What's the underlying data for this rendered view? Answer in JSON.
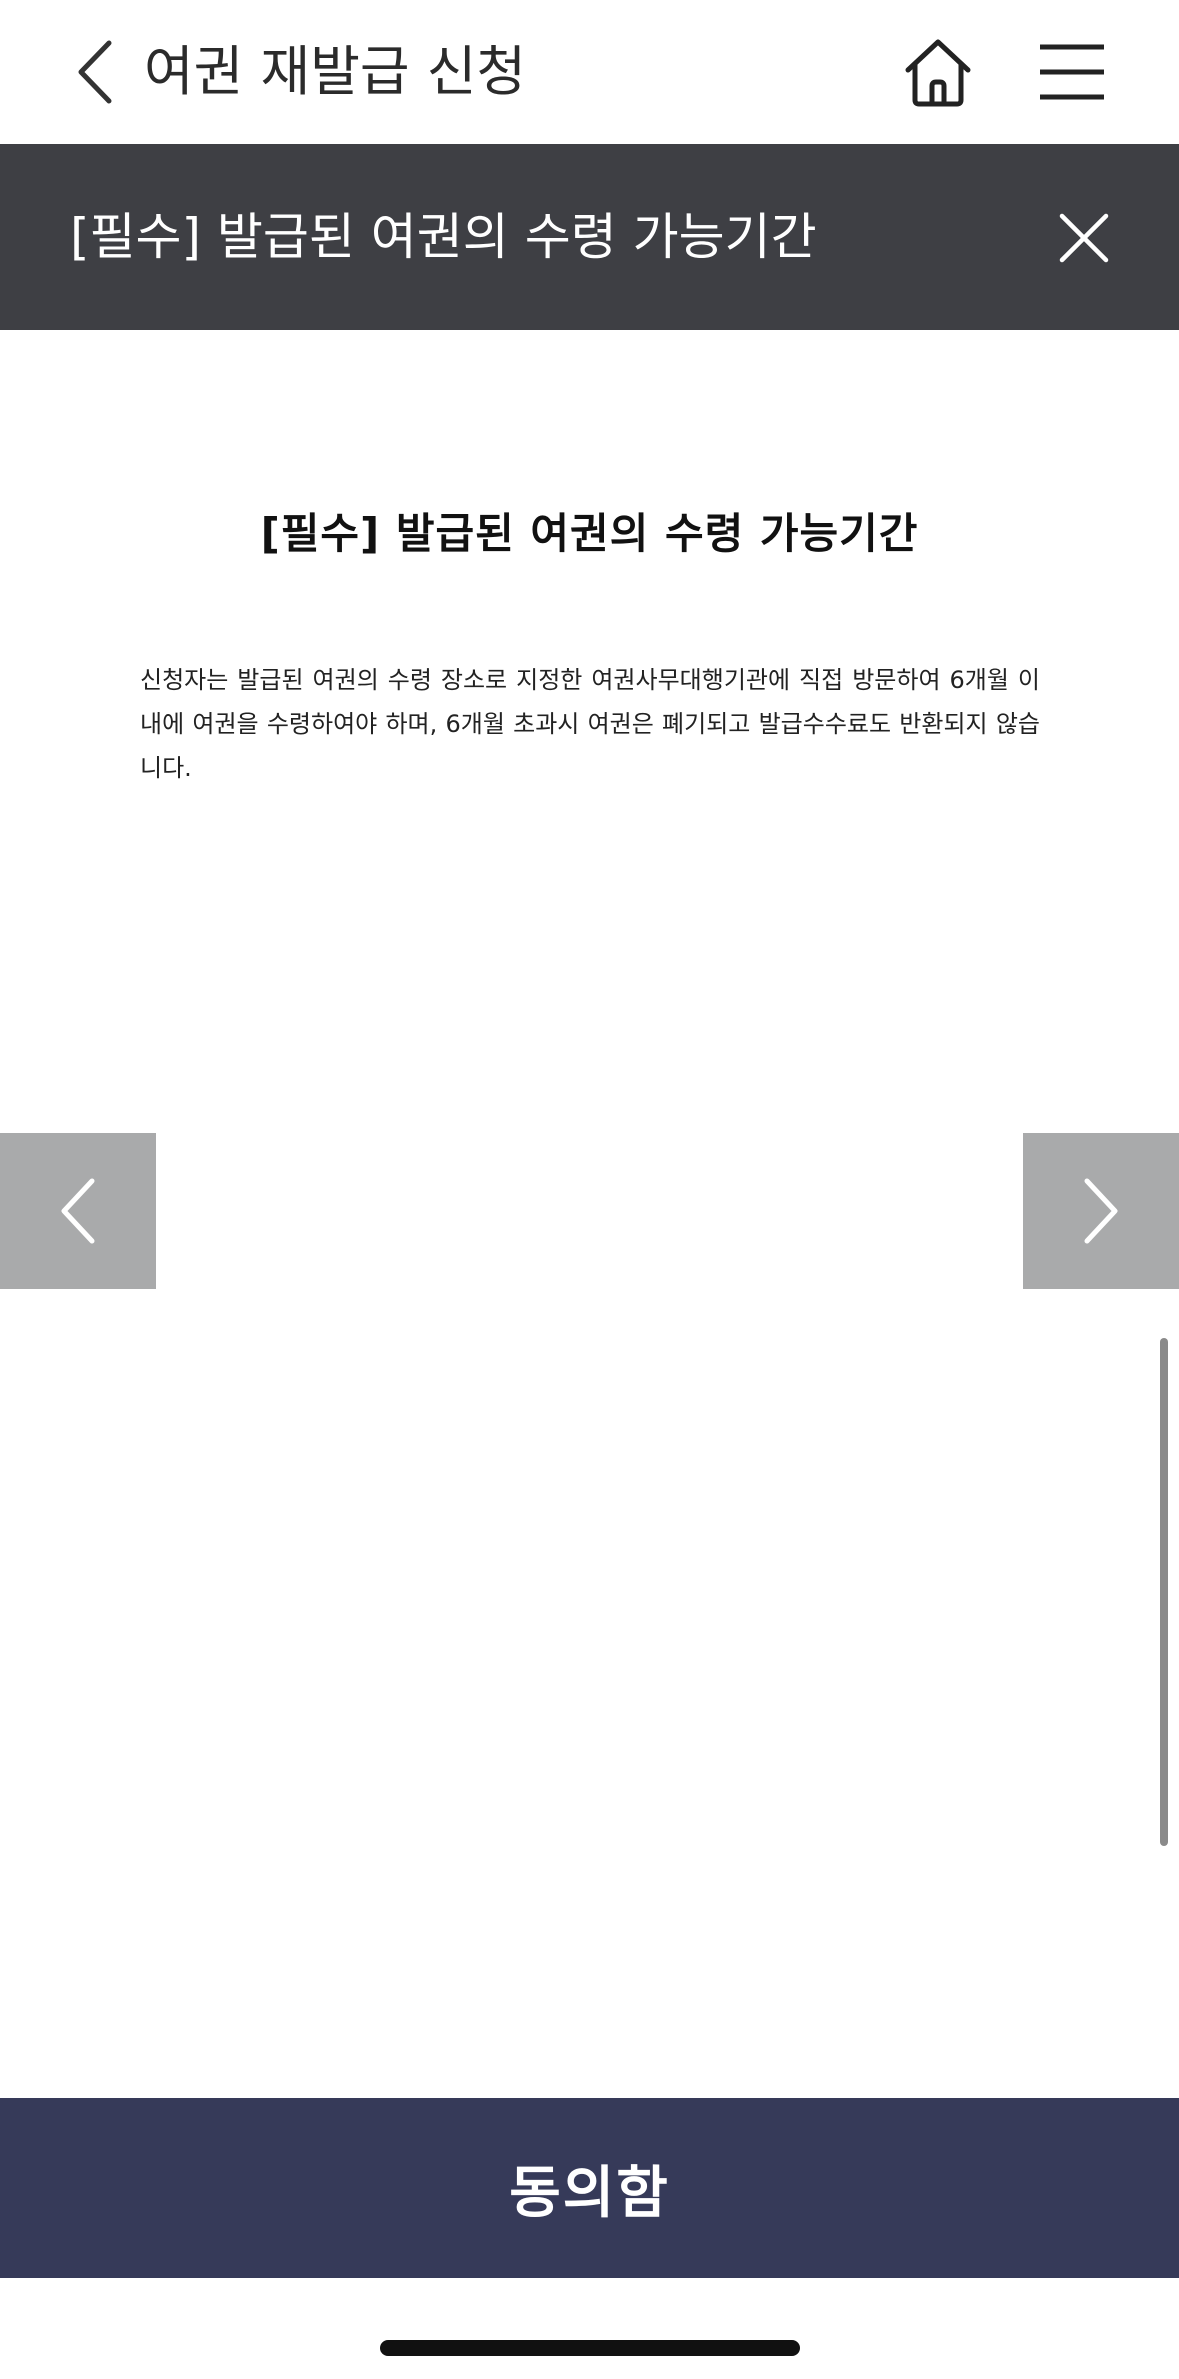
{
  "header": {
    "title": "여권 재발급 신청",
    "back_icon": "chevron-left-icon",
    "home_icon": "home-icon",
    "menu_icon": "hamburger-menu-icon"
  },
  "modal": {
    "title": "[필수] 발급된 여권의 수령 가능기간",
    "close_icon": "close-icon",
    "heading": "[필수] 발급된 여권의 수령 가능기간",
    "body": "신청자는 발급된 여권의 수령 장소로 지정한 여권사무대행기관에 직접 방문하여 6개월 이내에 여권을 수령하여야 하며, 6개월 초과시 여권은 폐기되고 발급수수료도 반환되지 않습니다."
  },
  "navigation": {
    "prev_icon": "chevron-left-icon",
    "next_icon": "chevron-right-icon"
  },
  "footer": {
    "agree_label": "동의함"
  },
  "colors": {
    "modal_bar": "#3e3f44",
    "agree_button": "#363a59",
    "nav_button": "#a9aaab"
  }
}
